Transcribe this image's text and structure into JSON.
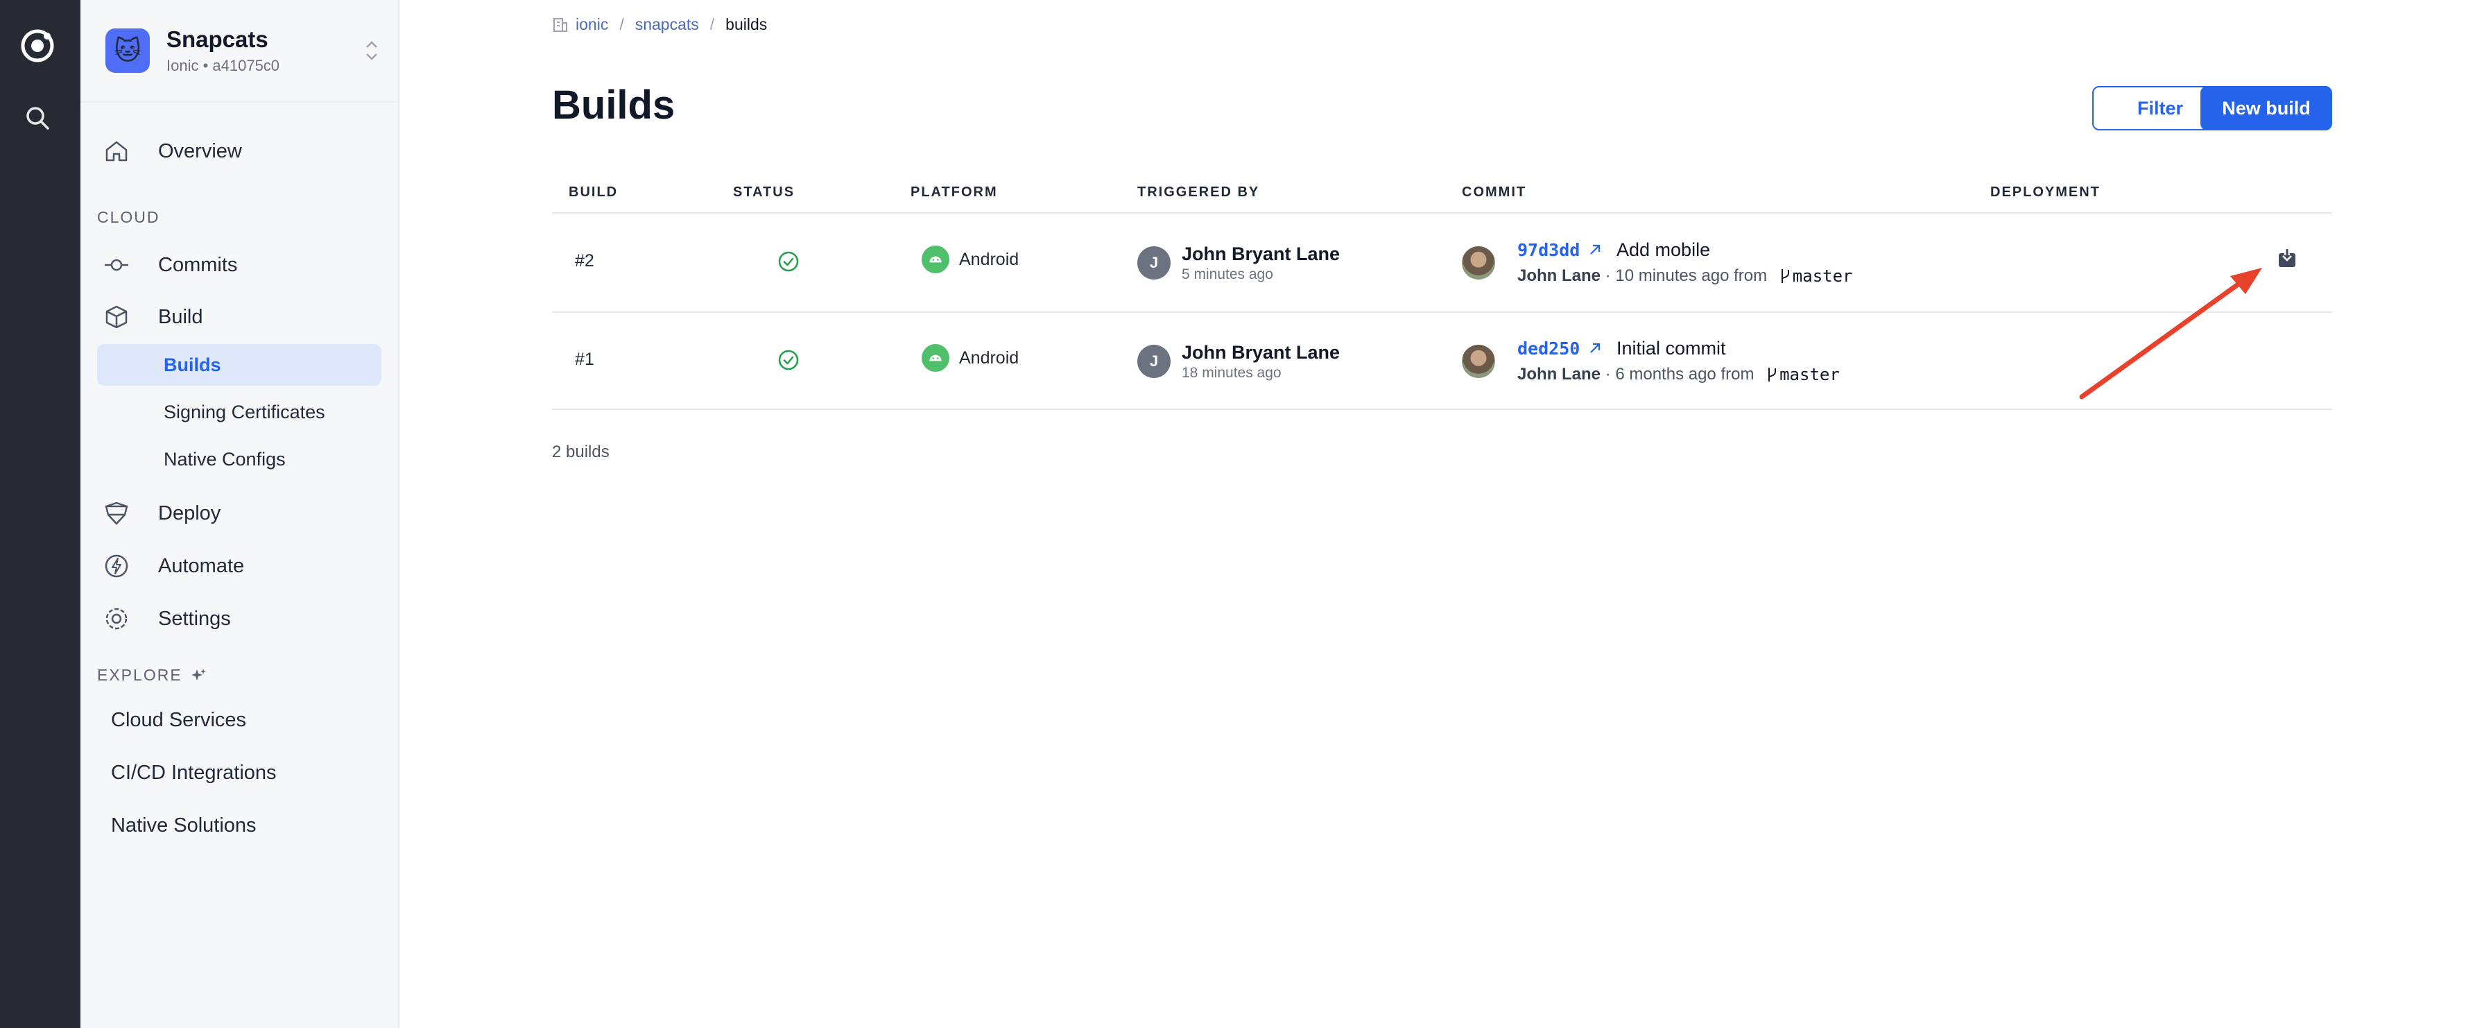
{
  "rail": {
    "logo_icon": "ionic-logo-icon",
    "search_icon": "search-icon"
  },
  "app": {
    "name": "Snapcats",
    "subtitle": "Ionic • a41075c0",
    "avatar_emoji": "🐱"
  },
  "sidebar": {
    "overview": "Overview",
    "cloud_section": "CLOUD",
    "commits": "Commits",
    "build": "Build",
    "builds": "Builds",
    "signing_certificates": "Signing Certificates",
    "native_configs": "Native Configs",
    "deploy": "Deploy",
    "automate": "Automate",
    "settings": "Settings",
    "explore_section": "EXPLORE",
    "explore_items": [
      "Cloud Services",
      "CI/CD Integrations",
      "Native Solutions"
    ]
  },
  "breadcrumb": {
    "org": "ionic",
    "app": "snapcats",
    "current": "builds",
    "separator": "/"
  },
  "page": {
    "title": "Builds",
    "filter_label": "Filter",
    "new_build_label": "New build"
  },
  "table": {
    "headers": [
      "BUILD",
      "STATUS",
      "PLATFORM",
      "TRIGGERED BY",
      "COMMIT",
      "DEPLOYMENT"
    ],
    "rows": [
      {
        "build": "#2",
        "status": "success",
        "platform": "Android",
        "user_initial": "J",
        "user_name": "John Bryant Lane",
        "user_time": "5 minutes ago",
        "commit_hash": "97d3dd",
        "commit_message": "Add mobile",
        "commit_author": "John Lane",
        "commit_meta": " · 10 minutes ago from ",
        "branch": "master",
        "deployment_icon": "download-icon"
      },
      {
        "build": "#1",
        "status": "success",
        "platform": "Android",
        "user_initial": "J",
        "user_name": "John Bryant Lane",
        "user_time": "18 minutes ago",
        "commit_hash": "ded250",
        "commit_message": "Initial commit",
        "commit_author": "John Lane",
        "commit_meta": " · 6 months ago from ",
        "branch": "master"
      }
    ]
  },
  "footer": {
    "count": "2 builds"
  },
  "colors": {
    "rail": "#262b33",
    "accent": "#2563eb",
    "success": "#22a049",
    "android": "#4fbf6b",
    "annotation": "#e8412c"
  }
}
